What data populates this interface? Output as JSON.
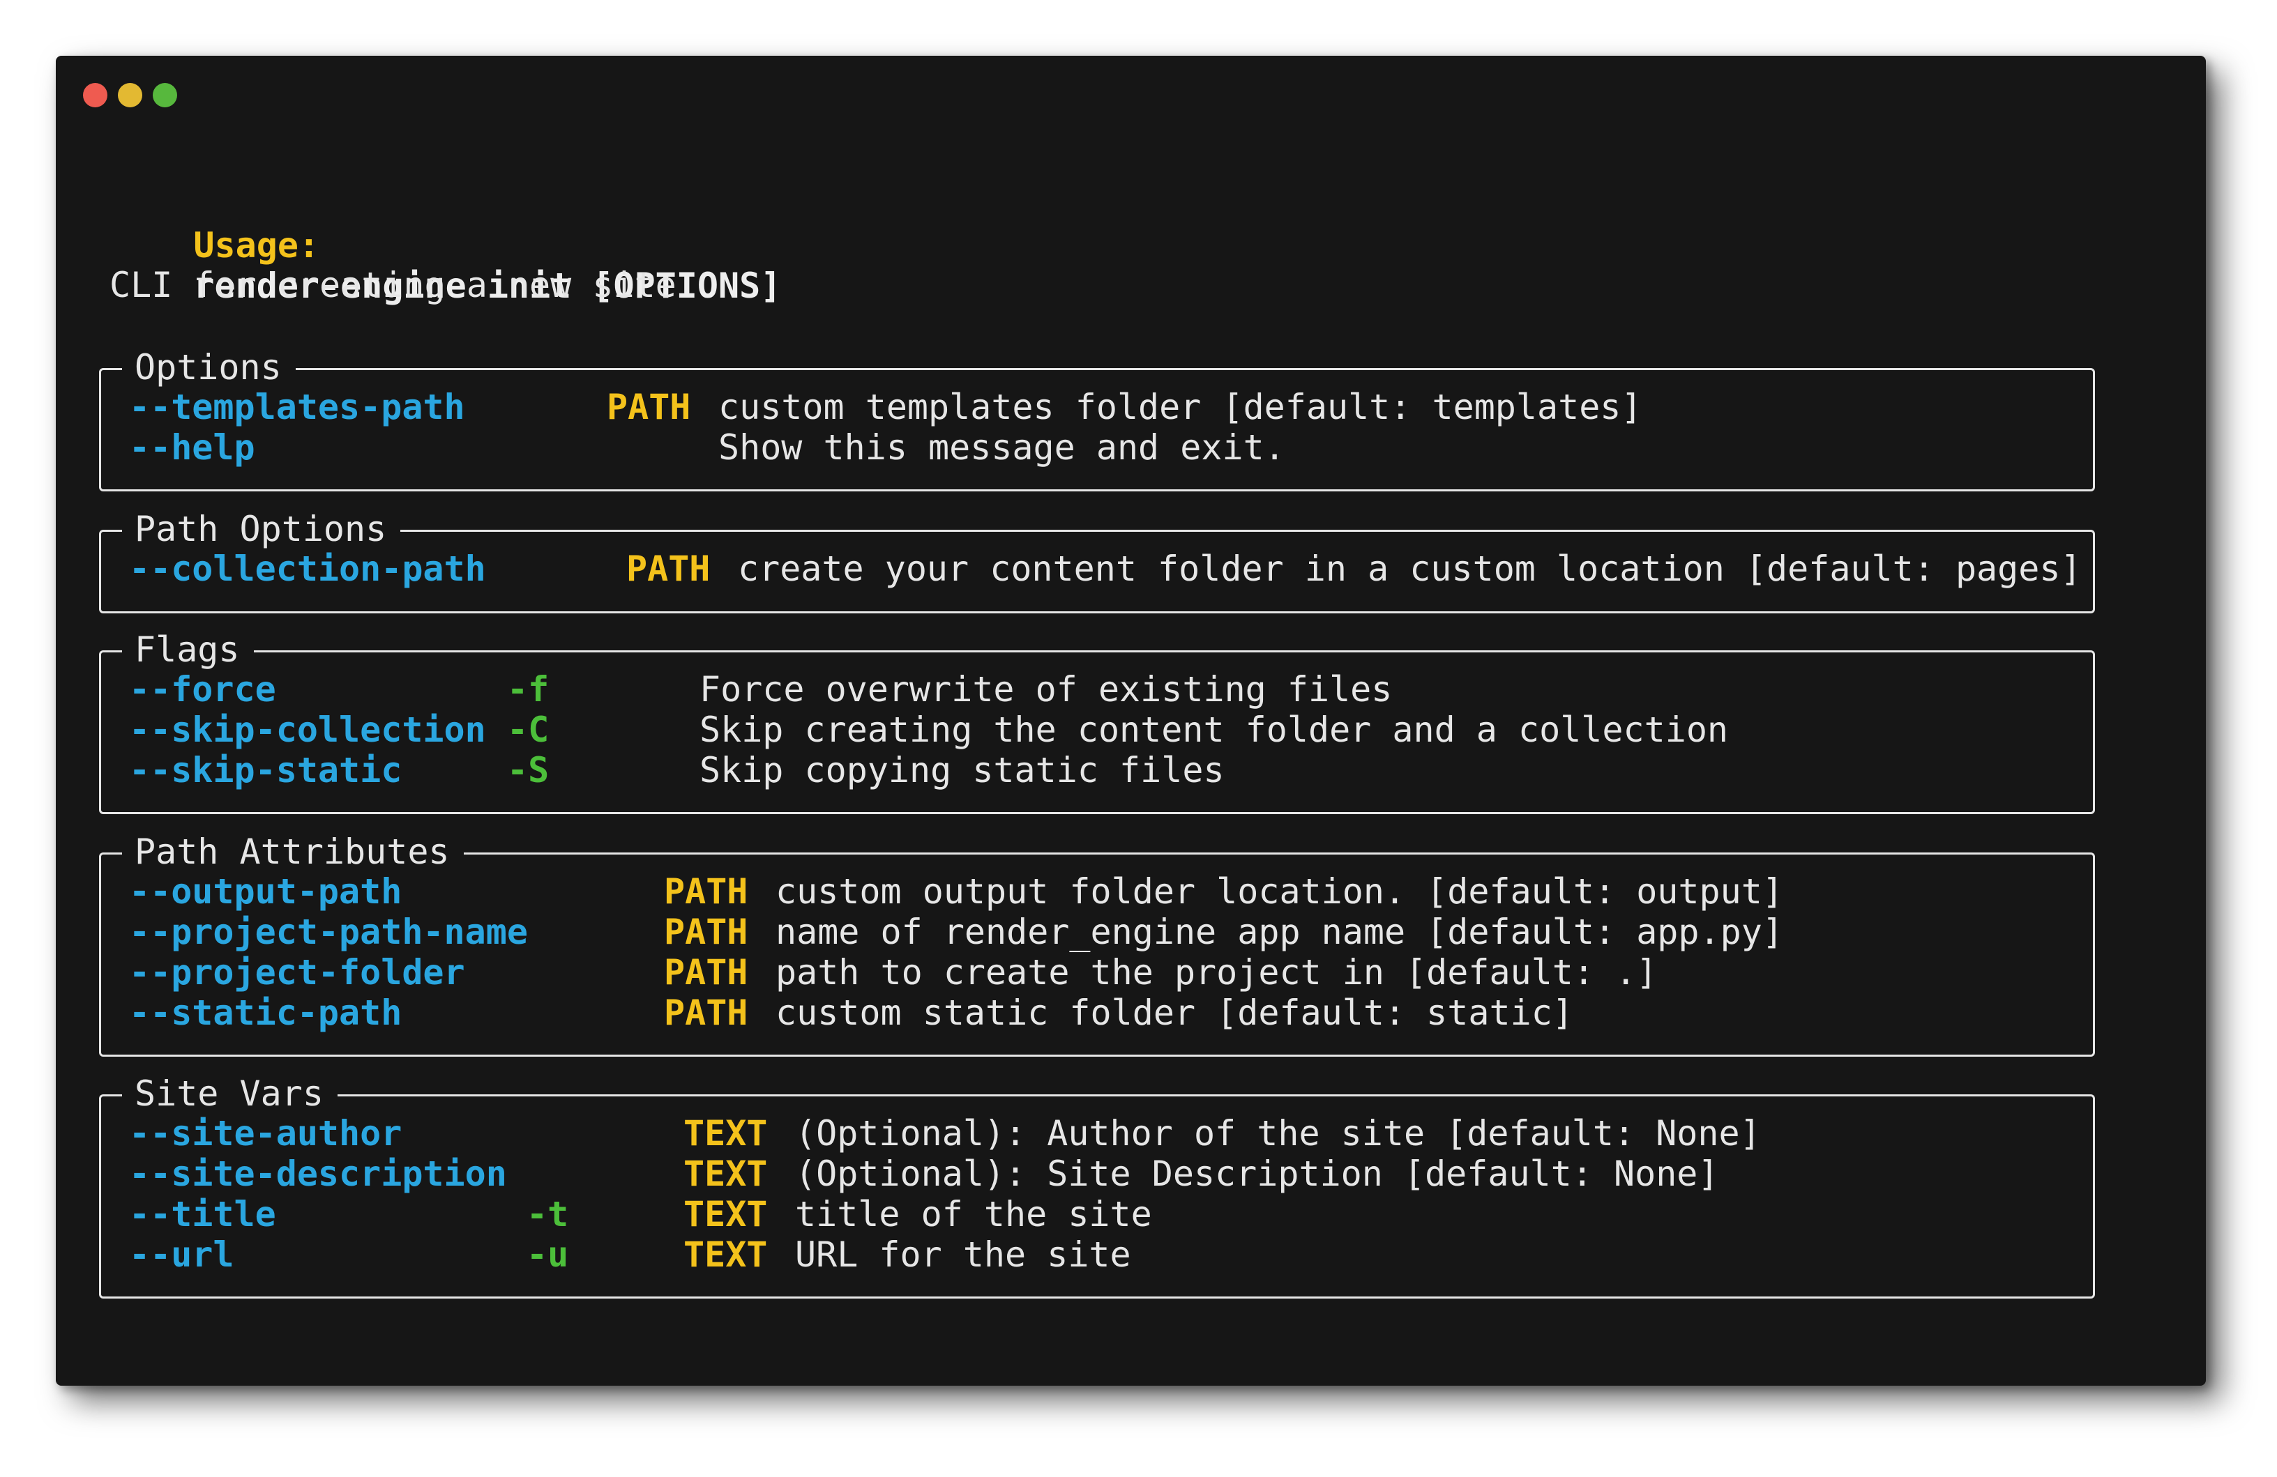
{
  "window": {
    "controls": [
      "close",
      "minimize",
      "maximize"
    ]
  },
  "usage": {
    "label": "Usage:",
    "command": "render-engine init [OPTIONS]"
  },
  "description": "CLI for creating a new site",
  "panels": [
    {
      "title": "Options",
      "rows": [
        {
          "option": "--templates-path",
          "short": "",
          "type": "PATH",
          "desc": "custom templates folder [default: templates]"
        },
        {
          "option": "--help",
          "short": "",
          "type": "",
          "desc": "Show this message and exit."
        }
      ]
    },
    {
      "title": "Path Options",
      "rows": [
        {
          "option": "--collection-path",
          "short": "",
          "type": "PATH",
          "desc": "create your content folder in a custom location [default: pages]"
        }
      ]
    },
    {
      "title": "Flags",
      "rows": [
        {
          "option": "--force",
          "short": "-f",
          "type": "",
          "desc": "Force overwrite of existing files"
        },
        {
          "option": "--skip-collection",
          "short": "-C",
          "type": "",
          "desc": "Skip creating the content folder and a collection"
        },
        {
          "option": "--skip-static",
          "short": "-S",
          "type": "",
          "desc": "Skip copying static files"
        }
      ]
    },
    {
      "title": "Path Attributes",
      "rows": [
        {
          "option": "--output-path",
          "short": "",
          "type": "PATH",
          "desc": "custom output folder location. [default: output]"
        },
        {
          "option": "--project-path-name",
          "short": "",
          "type": "PATH",
          "desc": "name of render_engine app name [default: app.py]"
        },
        {
          "option": "--project-folder",
          "short": "",
          "type": "PATH",
          "desc": "path to create the project in [default: .]"
        },
        {
          "option": "--static-path",
          "short": "",
          "type": "PATH",
          "desc": "custom static folder [default: static]"
        }
      ]
    },
    {
      "title": "Site Vars",
      "rows": [
        {
          "option": "--site-author",
          "short": "",
          "type": "TEXT",
          "desc": "(Optional): Author of the site [default: None]"
        },
        {
          "option": "--site-description",
          "short": "",
          "type": "TEXT",
          "desc": "(Optional): Site Description [default: None]"
        },
        {
          "option": "--title",
          "short": "-t",
          "type": "TEXT",
          "desc": "title of the site"
        },
        {
          "option": "--url",
          "short": "-u",
          "type": "TEXT",
          "desc": "URL for the site"
        }
      ]
    }
  ]
}
